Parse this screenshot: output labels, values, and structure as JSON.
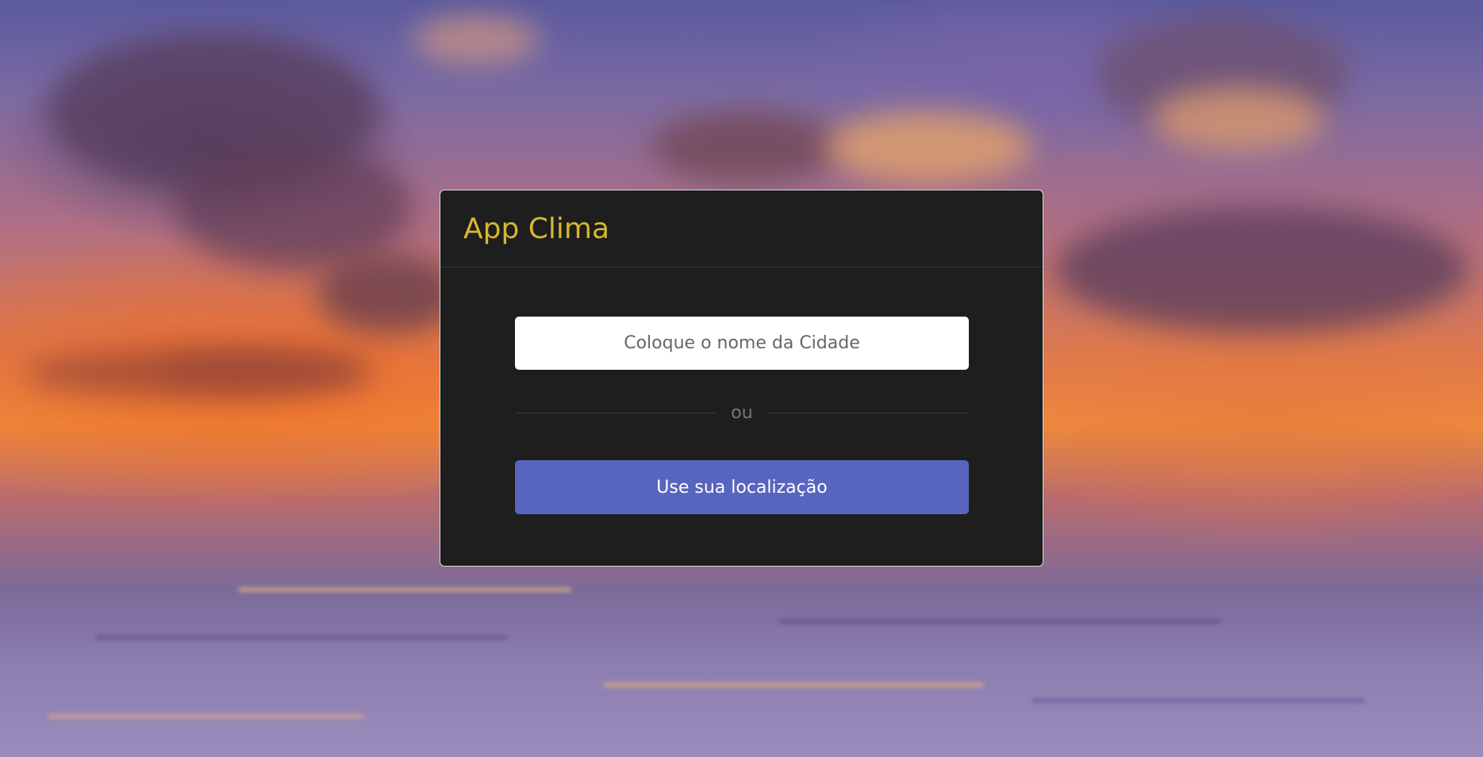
{
  "app": {
    "title": "App Clima"
  },
  "search": {
    "placeholder": "Coloque o nome da Cidade",
    "value": ""
  },
  "divider": {
    "label": "ou"
  },
  "actions": {
    "location_label": "Use sua localização"
  },
  "colors": {
    "card_background": "#1e1e1e",
    "title_accent": "#d8b72c",
    "button_accent": "#5865be",
    "input_background": "#ffffff"
  }
}
